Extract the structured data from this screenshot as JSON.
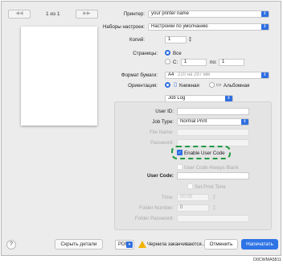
{
  "preview": {
    "prev_icon": "◀◀",
    "next_icon": "▶▶",
    "page_counter": "1 из 1",
    "help_label": "?",
    "hide_details_label": "Скрыть детали"
  },
  "settings": {
    "printer_label": "Принтер:",
    "printer_value": "your printer name",
    "presets_label": "Наборы настроек:",
    "presets_value": "Настройки по умолчанию",
    "copies_label": "Копий:",
    "copies_value": "1",
    "pages_label": "Страницы:",
    "pages_all_label": "Все",
    "pages_from_label": "С:",
    "pages_from_value": "1",
    "pages_to_label": "по:",
    "pages_to_value": "1",
    "paper_label": "Формат бумаги:",
    "paper_value": "A4",
    "paper_size": "210 на 297 мм",
    "orientation_label": "Ориентация:",
    "orientation_portrait": "Книжная",
    "orientation_landscape": "Альбомная",
    "section_value": "Job Log"
  },
  "job_log": {
    "user_id_label": "User ID:",
    "user_id_value": "",
    "job_type_label": "Job Type:",
    "job_type_value": "Normal Print",
    "file_name_label": "File Name:",
    "password_label": "Password:",
    "enable_user_code_label": "Enable User Code",
    "enable_user_code_checked": true,
    "user_code_always_blank_label": "User Code Always Blank",
    "user_code_label": "User Code:",
    "set_print_time_label": "Set Print Time",
    "time_label": "Time:",
    "time_value": "00:00",
    "folder_number_label": "Folder Number:",
    "folder_number_value": "0",
    "folder_password_label": "Folder Password:"
  },
  "footer": {
    "pdf_label": "PDF",
    "warning_text": "Чернила заканчиваются...",
    "cancel_label": "Отменить",
    "print_label": "Напечатать"
  },
  "figure_code": "D0CWMA5811",
  "colors": {
    "accent": "#2f6fe0",
    "highlight_dashed": "#1e9a3f",
    "warning": "#f2b400"
  }
}
